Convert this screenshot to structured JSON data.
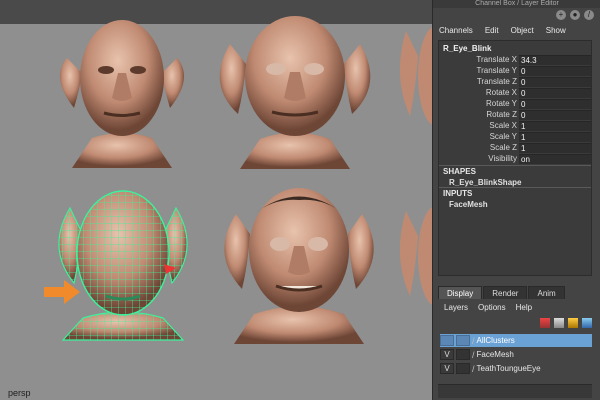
{
  "viewport": {
    "camera_label": "persp"
  },
  "panel": {
    "title": "Channel Box / Layer Editor",
    "menu": [
      "Channels",
      "Edit",
      "Object",
      "Show"
    ]
  },
  "channel_box": {
    "object_name": "R_Eye_Blink",
    "attributes": [
      {
        "label": "Translate X",
        "value": "34.3"
      },
      {
        "label": "Translate Y",
        "value": "0"
      },
      {
        "label": "Translate Z",
        "value": "0"
      },
      {
        "label": "Rotate X",
        "value": "0"
      },
      {
        "label": "Rotate Y",
        "value": "0"
      },
      {
        "label": "Rotate Z",
        "value": "0"
      },
      {
        "label": "Scale X",
        "value": "1"
      },
      {
        "label": "Scale Y",
        "value": "1"
      },
      {
        "label": "Scale Z",
        "value": "1"
      },
      {
        "label": "Visibility",
        "value": "on"
      }
    ],
    "shapes_header": "SHAPES",
    "shape_name": "R_Eye_BlinkShape",
    "inputs_header": "INPUTS",
    "input_name": "FaceMesh"
  },
  "layer_editor": {
    "tabs": [
      "Display",
      "Render",
      "Anim"
    ],
    "menu": [
      "Layers",
      "Options",
      "Help"
    ],
    "layers": [
      {
        "visible": "",
        "name": "AllClusters",
        "selected": true
      },
      {
        "visible": "V",
        "name": "FaceMesh",
        "selected": false
      },
      {
        "visible": "V",
        "name": "TeathToungueEye",
        "selected": false
      }
    ]
  },
  "colors": {
    "viewport_bg": "#8f8f8f",
    "skin": "#c9967e",
    "wireframe": "#3cf29c",
    "arrow": "#f08a2a",
    "selected_layer": "#6aa2d6"
  }
}
